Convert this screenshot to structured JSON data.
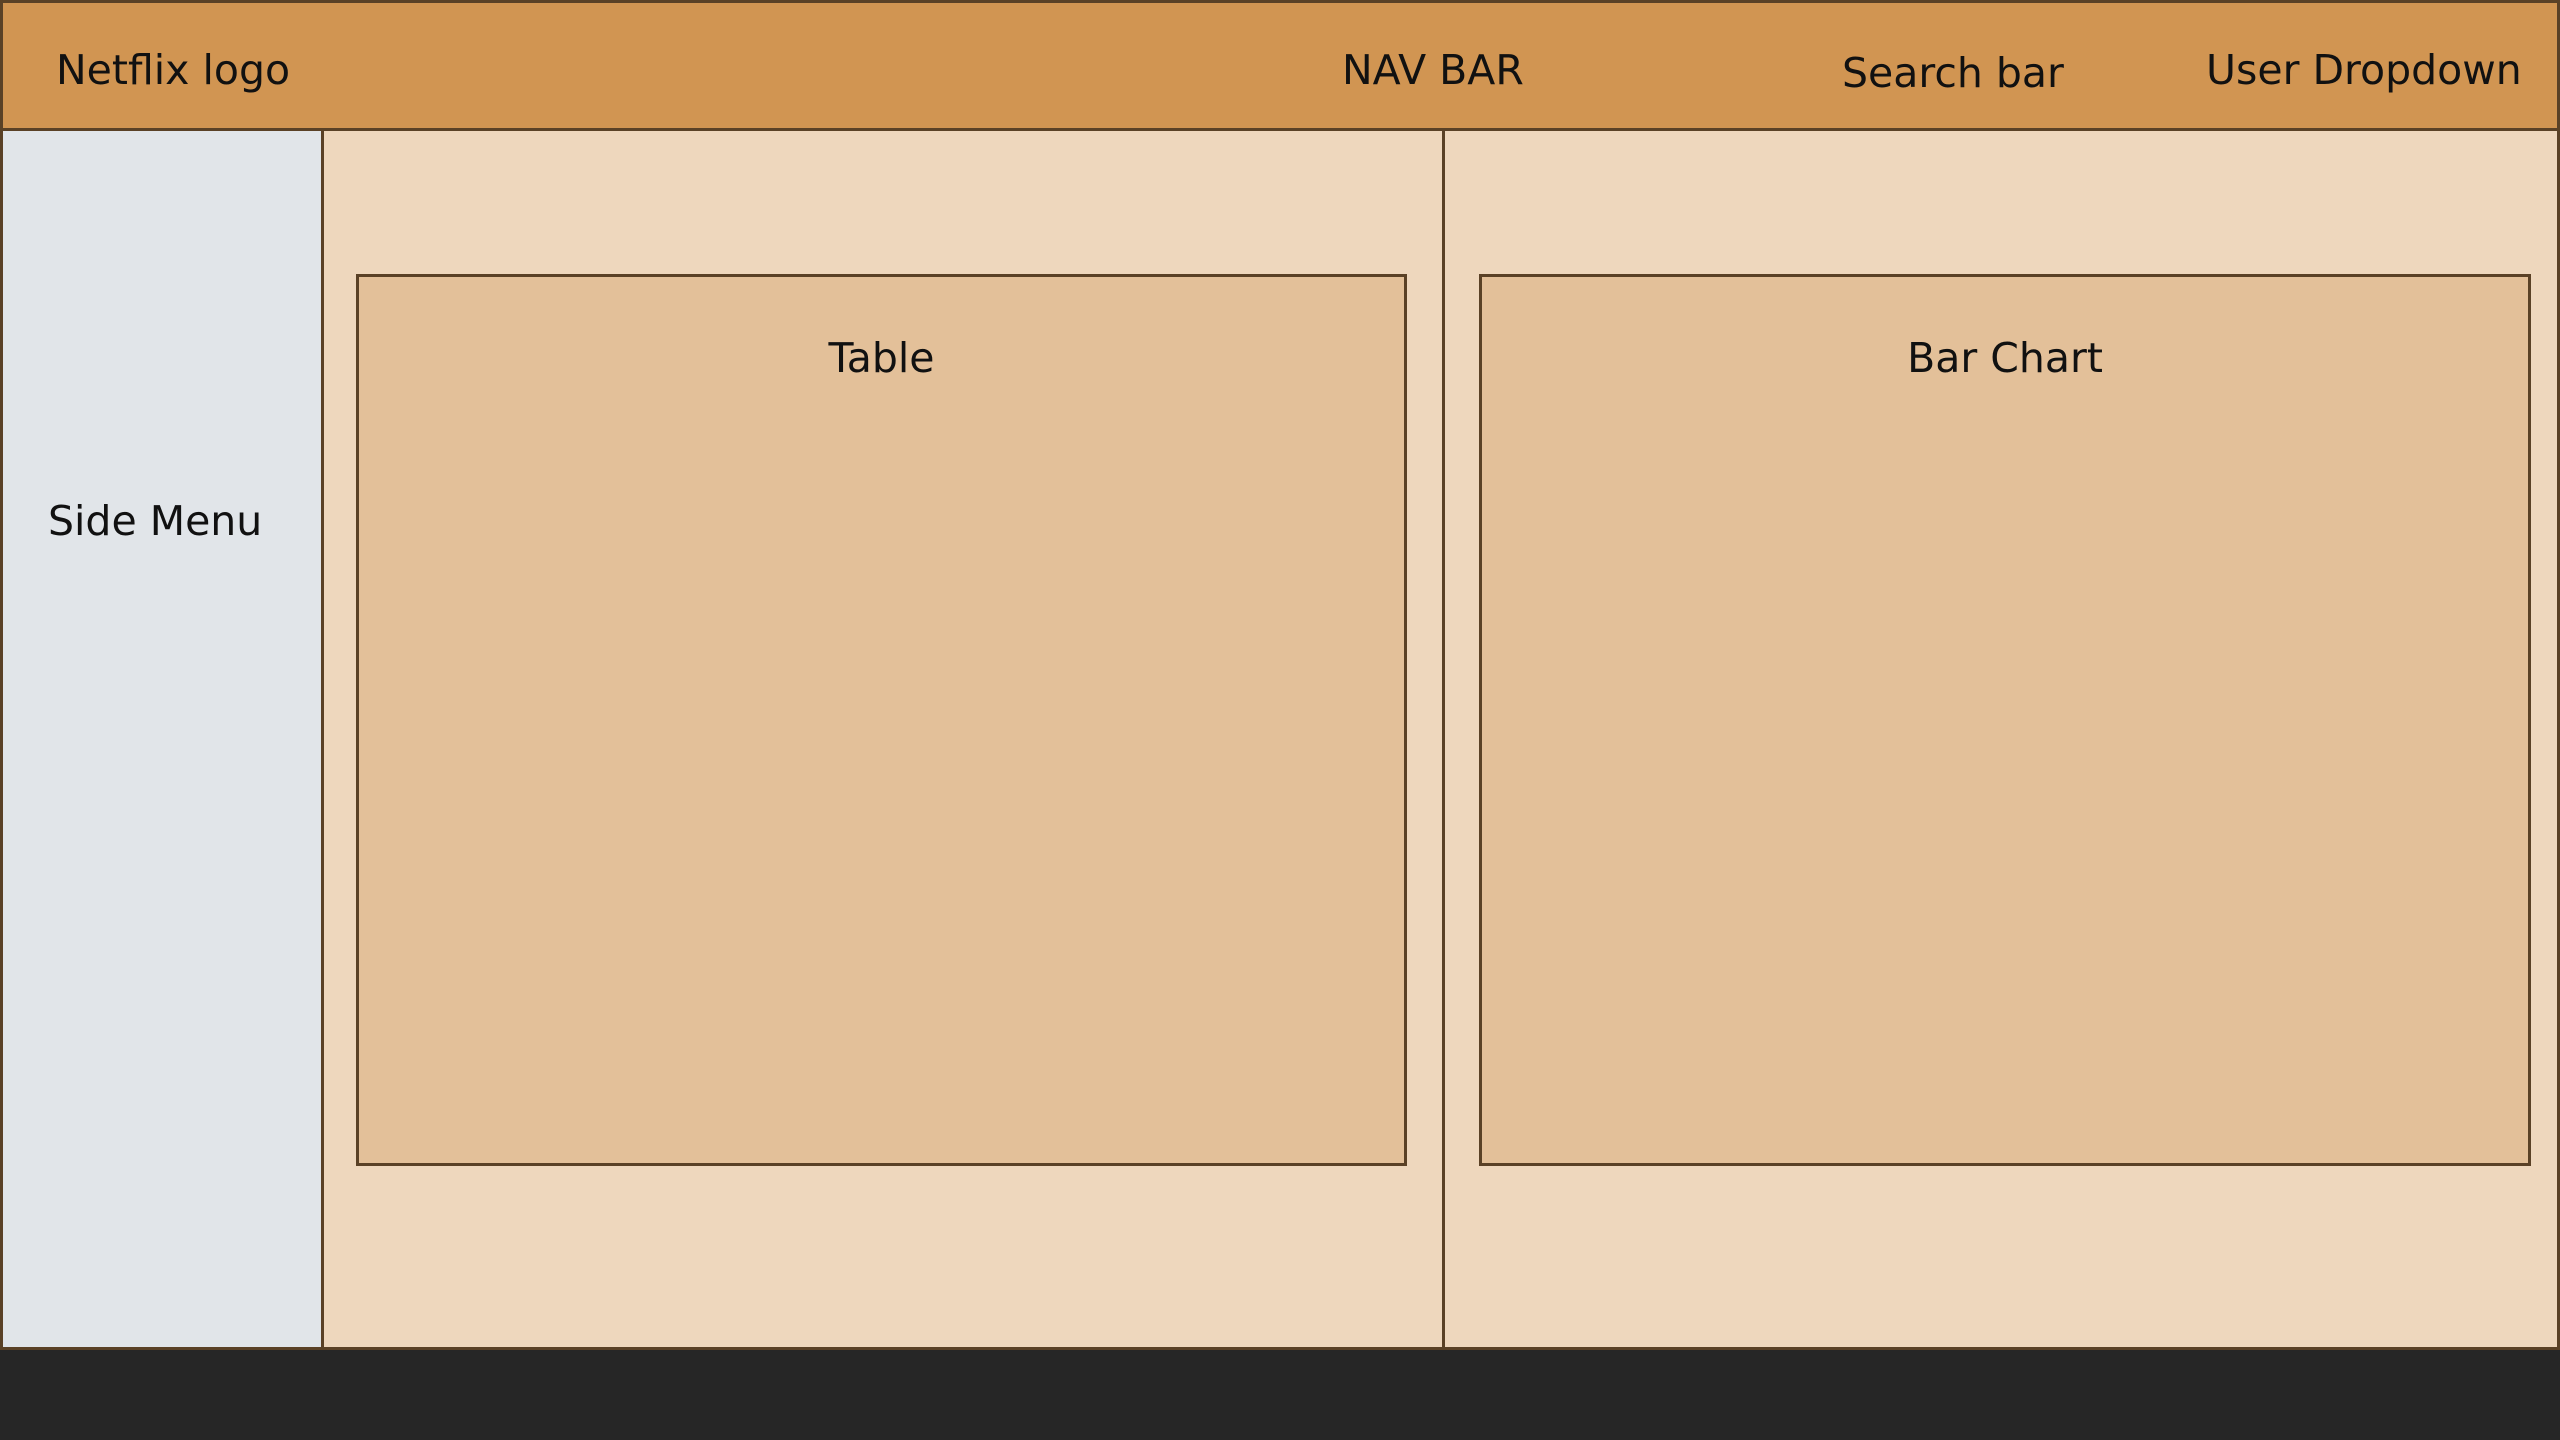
{
  "header": {
    "logo_label": "Netflix logo",
    "nav_label": "NAV BAR",
    "search_label": "Search bar",
    "user_label": "User Dropdown"
  },
  "sidebar": {
    "label": "Side Menu"
  },
  "main": {
    "table_label": "Table",
    "chart_label": "Bar Chart"
  },
  "colors": {
    "header": "#d19552",
    "sidebar": "#e1e5e9",
    "panel": "#eed7bd",
    "widget": "#e3c099",
    "border": "#5a4126",
    "footer": "#262626"
  }
}
